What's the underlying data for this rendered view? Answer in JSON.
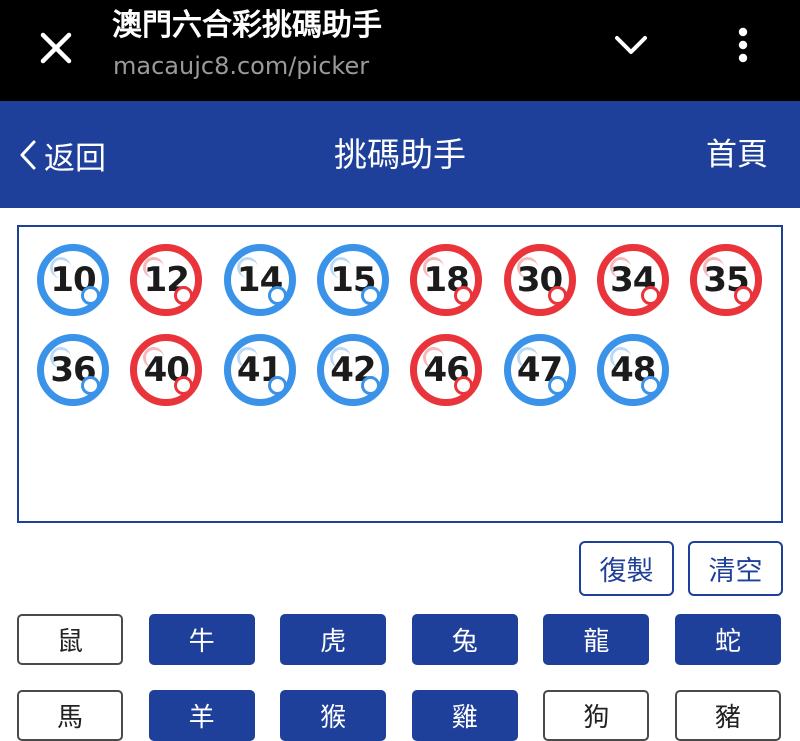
{
  "browser": {
    "title": "澳門六合彩挑碼助手",
    "url": "macaujc8.com/picker"
  },
  "header": {
    "back_label": "返回",
    "title": "挑碼助手",
    "home_label": "首頁"
  },
  "picked_numbers": [
    {
      "num": "10",
      "color": "blue"
    },
    {
      "num": "12",
      "color": "red"
    },
    {
      "num": "14",
      "color": "blue"
    },
    {
      "num": "15",
      "color": "blue"
    },
    {
      "num": "18",
      "color": "red"
    },
    {
      "num": "30",
      "color": "red"
    },
    {
      "num": "34",
      "color": "red"
    },
    {
      "num": "35",
      "color": "red"
    },
    {
      "num": "36",
      "color": "blue"
    },
    {
      "num": "40",
      "color": "red"
    },
    {
      "num": "41",
      "color": "blue"
    },
    {
      "num": "42",
      "color": "blue"
    },
    {
      "num": "46",
      "color": "red"
    },
    {
      "num": "47",
      "color": "blue"
    },
    {
      "num": "48",
      "color": "blue"
    }
  ],
  "actions": {
    "copy_label": "復製",
    "clear_label": "清空"
  },
  "zodiac": [
    {
      "label": "鼠",
      "selected": false
    },
    {
      "label": "牛",
      "selected": true
    },
    {
      "label": "虎",
      "selected": true
    },
    {
      "label": "兔",
      "selected": true
    },
    {
      "label": "龍",
      "selected": true
    },
    {
      "label": "蛇",
      "selected": true
    },
    {
      "label": "馬",
      "selected": false
    },
    {
      "label": "羊",
      "selected": true
    },
    {
      "label": "猴",
      "selected": true
    },
    {
      "label": "雞",
      "selected": true
    },
    {
      "label": "狗",
      "selected": false
    },
    {
      "label": "豬",
      "selected": false
    }
  ],
  "colors": {
    "primary": "#1e3f9a",
    "ball_blue": "#3a93e8",
    "ball_red": "#e8343a"
  }
}
